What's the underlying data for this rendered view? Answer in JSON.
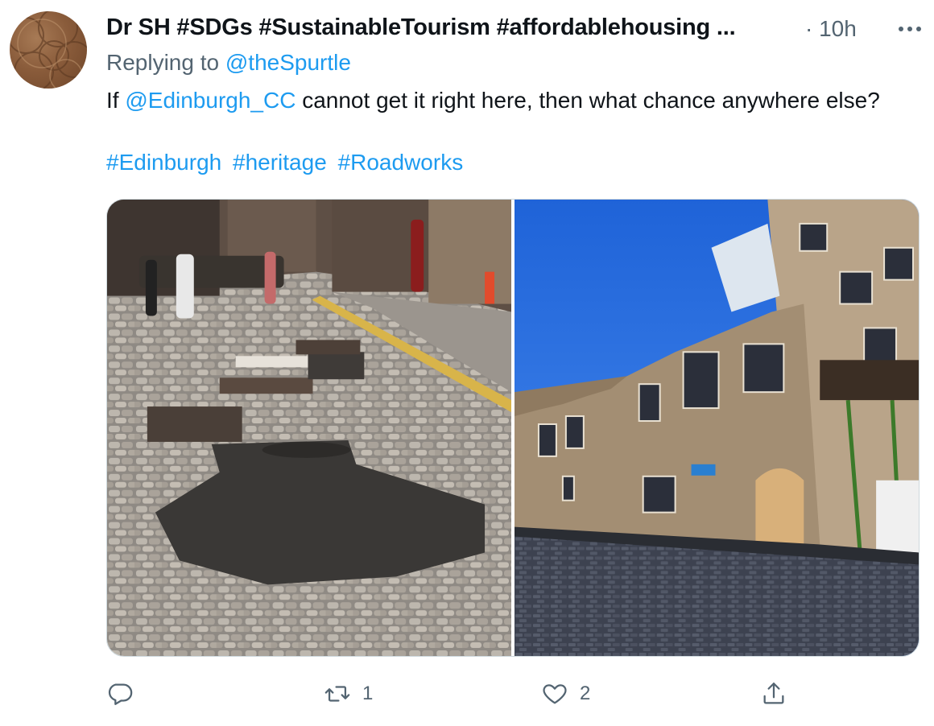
{
  "tweet": {
    "author_name": "Dr SH #SDGs #SustainableTourism #affordablehousing ...",
    "time": "· 10h",
    "replying_prefix": "Replying to ",
    "replying_handle": "@theSpurtle",
    "text_before": "If ",
    "mention": "@Edinburgh_CC",
    "text_after": " cannot get it right here, then what chance anywhere else?",
    "hashtags": [
      "#Edinburgh",
      "#heritage",
      "#Roadworks"
    ],
    "media": [
      {
        "icon": "photo-cobbled-street-patched"
      },
      {
        "icon": "photo-stone-building-street"
      }
    ],
    "actions": {
      "reply": {
        "icon": "reply-icon",
        "count": ""
      },
      "retweet": {
        "icon": "retweet-icon",
        "count": "1"
      },
      "like": {
        "icon": "heart-icon",
        "count": "2"
      },
      "share": {
        "icon": "share-icon",
        "count": ""
      }
    }
  },
  "colors": {
    "link": "#1d9bf0",
    "muted": "#536471",
    "text": "#0f1419"
  }
}
